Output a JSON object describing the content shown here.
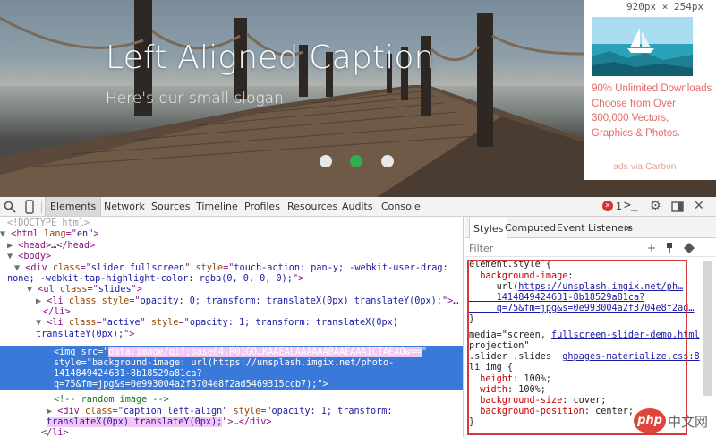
{
  "hero": {
    "title": "Left Aligned Caption",
    "slogan": "Here's our small slogan.",
    "dots": [
      {
        "state": "inactive"
      },
      {
        "state": "active"
      },
      {
        "state": "inactive"
      }
    ],
    "colors": {
      "active_dot": "#2fae4e",
      "inactive_dot": "#e8e8e8"
    }
  },
  "ad": {
    "size_tag": "920px × 254px",
    "text": "90% Unlimited Downloads Choose from Over 300,000 Vectors, Graphics & Photos.",
    "via": "ads via Carbon"
  },
  "toolbar": {
    "tabs": [
      "Elements",
      "Network",
      "Sources",
      "Timeline",
      "Profiles",
      "Resources",
      "Audits",
      "Console"
    ],
    "active_tab": "Elements",
    "error_count": "1"
  },
  "elements": {
    "lines": [
      {
        "parts": [
          [
            "dim",
            "<!DOCTYPE html>"
          ]
        ]
      },
      {
        "parts": [
          [
            "tri",
            "▼"
          ],
          [
            "tag",
            "<html "
          ],
          [
            "attr",
            "lang"
          ],
          [
            "tag",
            "=\""
          ],
          [
            "val",
            "en"
          ],
          [
            "tag",
            "\">"
          ]
        ]
      },
      {
        "parts": [
          [
            "tri",
            "▶"
          ],
          [
            "tag",
            "<head>"
          ],
          [
            "txt",
            "…"
          ],
          [
            "tag",
            "</head>"
          ]
        ]
      },
      {
        "parts": [
          [
            "tri",
            "▼"
          ],
          [
            "tag",
            "<body>"
          ]
        ]
      },
      {
        "parts": [
          [
            "tri",
            "▼"
          ],
          [
            "tag",
            "<div "
          ],
          [
            "attr",
            "class"
          ],
          [
            "tag",
            "=\""
          ],
          [
            "val",
            "slider fullscreen"
          ],
          [
            "tag",
            "\" "
          ],
          [
            "attr",
            "style"
          ],
          [
            "tag",
            "=\""
          ],
          [
            "val",
            "touch-action: pan-y; -webkit-user-drag:"
          ]
        ]
      },
      {
        "parts": [
          [
            "val",
            "none; -webkit-tap-highlight-color: rgba(0, 0, 0, 0);"
          ],
          [
            "tag",
            "\">"
          ]
        ]
      },
      {
        "parts": [
          [
            "tri",
            "▼"
          ],
          [
            "tag",
            "<ul "
          ],
          [
            "attr",
            "class"
          ],
          [
            "tag",
            "=\""
          ],
          [
            "val",
            "slides"
          ],
          [
            "tag",
            "\">"
          ]
        ]
      },
      {
        "parts": [
          [
            "tri",
            "▶"
          ],
          [
            "tag",
            "<li "
          ],
          [
            "attr",
            "class"
          ],
          [
            "tag",
            " "
          ],
          [
            "attr",
            "style"
          ],
          [
            "tag",
            "=\""
          ],
          [
            "val",
            "opacity: 0; transform: translateX(0px) translateY(0px);"
          ],
          [
            "tag",
            "\">"
          ],
          [
            "txt",
            "…"
          ]
        ]
      },
      {
        "parts": [
          [
            "tag",
            "</li>"
          ]
        ]
      },
      {
        "parts": [
          [
            "tri",
            "▼"
          ],
          [
            "tag",
            "<li "
          ],
          [
            "attr",
            "class"
          ],
          [
            "tag",
            "=\""
          ],
          [
            "val",
            "active"
          ],
          [
            "tag",
            "\" "
          ],
          [
            "attr",
            "style"
          ],
          [
            "tag",
            "=\""
          ],
          [
            "val",
            "opacity: 1; transform: translateX(0px)"
          ]
        ]
      },
      {
        "parts": [
          [
            "val",
            "translateY(0px);"
          ],
          [
            "tag",
            "\">"
          ]
        ]
      },
      {
        "parts": [
          [
            "tag",
            "<img "
          ],
          [
            "attr",
            "src"
          ],
          [
            "tag",
            "=\""
          ],
          [
            "val",
            "data:image/gif;base64,R01GO…KAAEALAAAAAABAAEAAAICTAEAOw=="
          ],
          [
            "tag",
            "\""
          ]
        ]
      },
      {
        "parts": [
          [
            "attr",
            "style"
          ],
          [
            "tag",
            "=\""
          ],
          [
            "val",
            "background-image: url(https://unsplash.imgix.net/photo-"
          ]
        ]
      },
      {
        "parts": [
          [
            "val",
            "1414849424631-8b18529a81ca?"
          ]
        ]
      },
      {
        "parts": [
          [
            "val",
            "q=75&fm=jpg&s=0e993004a2f3704e8f2ad5469315ccb7);"
          ],
          [
            "tag",
            "\">"
          ]
        ]
      },
      {
        "parts": [
          [
            "cmt",
            "<!-- random image -->"
          ]
        ]
      },
      {
        "parts": [
          [
            "tri",
            "▶"
          ],
          [
            "tag",
            "<div "
          ],
          [
            "attr",
            "class"
          ],
          [
            "tag",
            "=\""
          ],
          [
            "val",
            "caption left-align"
          ],
          [
            "tag",
            "\" "
          ],
          [
            "attr",
            "style"
          ],
          [
            "tag",
            "=\""
          ],
          [
            "val",
            "opacity: 1; transform:"
          ]
        ]
      },
      {
        "parts": [
          [
            "val",
            "translateX(0px) translateY(0px);"
          ],
          [
            "tag",
            "\">"
          ],
          [
            "txt",
            "…"
          ],
          [
            "tag",
            "</div>"
          ]
        ]
      },
      {
        "parts": [
          [
            "tag",
            "</li>"
          ]
        ]
      }
    ]
  },
  "styles_pane": {
    "tabs": [
      "Styles",
      "Computed",
      "Event Listeners"
    ],
    "active_tab": "Styles",
    "more": "»",
    "filter_placeholder": "Filter",
    "filter_icons": [
      "+",
      "pin",
      "palette"
    ],
    "rules": [
      {
        "parts": [
          [
            "txt",
            "element.style {"
          ]
        ]
      },
      {
        "parts": [
          [
            "prop",
            "  background-image"
          ],
          [
            "txt",
            ":"
          ]
        ]
      },
      {
        "parts": [
          [
            "txt",
            "     url("
          ],
          [
            "link",
            "https://unsplash.imgix.net/ph…"
          ]
        ]
      },
      {
        "parts": [
          [
            "link",
            "     1414849424631-8b18529a81ca?"
          ]
        ]
      },
      {
        "parts": [
          [
            "link",
            "     q=75&fm=jpg&s=0e993004a2f3704e8f2ad…"
          ]
        ]
      },
      {
        "parts": [
          [
            "txt",
            "}"
          ]
        ]
      },
      {
        "parts": [
          [
            "txt",
            "media=\"screen, "
          ],
          [
            "link",
            "fullscreen-slider-demo.html"
          ]
        ]
      },
      {
        "parts": [
          [
            "txt",
            "projection\""
          ]
        ]
      },
      {
        "parts": [
          [
            "txt",
            ".slider .slides  "
          ],
          [
            "link",
            "ghpages-materialize.css:8"
          ]
        ]
      },
      {
        "parts": [
          [
            "txt",
            "li img {"
          ]
        ]
      },
      {
        "parts": [
          [
            "prop",
            "  height"
          ],
          [
            "txt",
            ": 100%;"
          ]
        ]
      },
      {
        "parts": [
          [
            "prop",
            "  width"
          ],
          [
            "txt",
            ": 100%;"
          ]
        ]
      },
      {
        "parts": [
          [
            "prop",
            "  background-size"
          ],
          [
            "txt",
            ": cover;"
          ]
        ]
      },
      {
        "parts": [
          [
            "prop",
            "  background-position"
          ],
          [
            "txt",
            ": center;"
          ]
        ]
      },
      {
        "parts": [
          [
            "txt",
            "}"
          ]
        ]
      }
    ]
  },
  "watermark": {
    "logo": "php",
    "text": "中文网"
  }
}
